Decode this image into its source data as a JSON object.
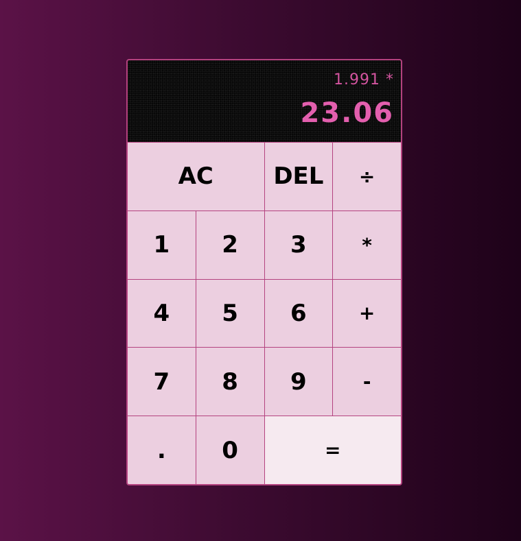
{
  "display": {
    "previous_operand": "1.991 *",
    "current_operand": "23.06"
  },
  "keys": {
    "clear": "AC",
    "delete": "DEL",
    "divide": "÷",
    "one": "1",
    "two": "2",
    "three": "3",
    "multiply": "*",
    "four": "4",
    "five": "5",
    "six": "6",
    "plus": "+",
    "seven": "7",
    "eight": "8",
    "nine": "9",
    "minus": "-",
    "decimal": ".",
    "zero": "0",
    "equals": "="
  },
  "colors": {
    "accent": "#b4427f",
    "display_text": "#e35fae",
    "key_background": "#eccfe0",
    "equals_background": "#f6eaf0",
    "display_background": "#070707"
  }
}
